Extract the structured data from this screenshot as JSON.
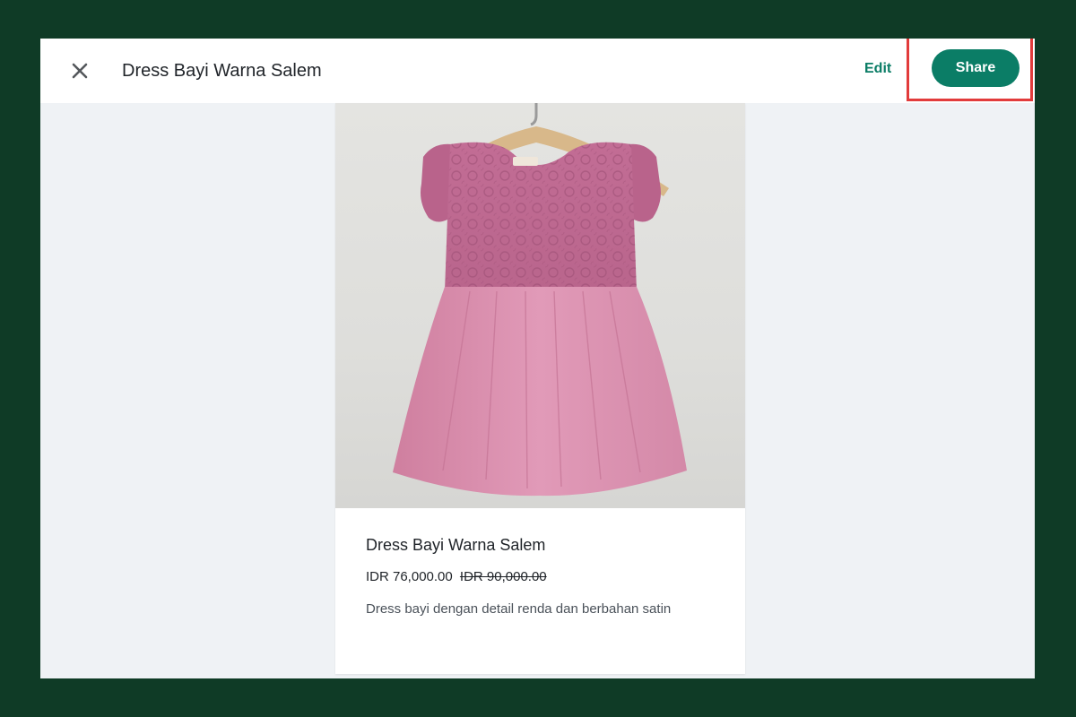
{
  "header": {
    "title": "Dress Bayi Warna Salem",
    "edit_label": "Edit",
    "share_label": "Share",
    "close_icon": "close-icon"
  },
  "product": {
    "name": "Dress Bayi Warna Salem",
    "price": "IDR 76,000.00",
    "original_price": "IDR 90,000.00",
    "description": "Dress bayi dengan detail renda dan berbahan satin",
    "image_subject": "pink lace baby dress on wooden hanger"
  },
  "colors": {
    "accent": "#0b7d66",
    "highlight": "#e23b3b",
    "frame": "#0f3b26",
    "panel": "#eff2f5"
  }
}
